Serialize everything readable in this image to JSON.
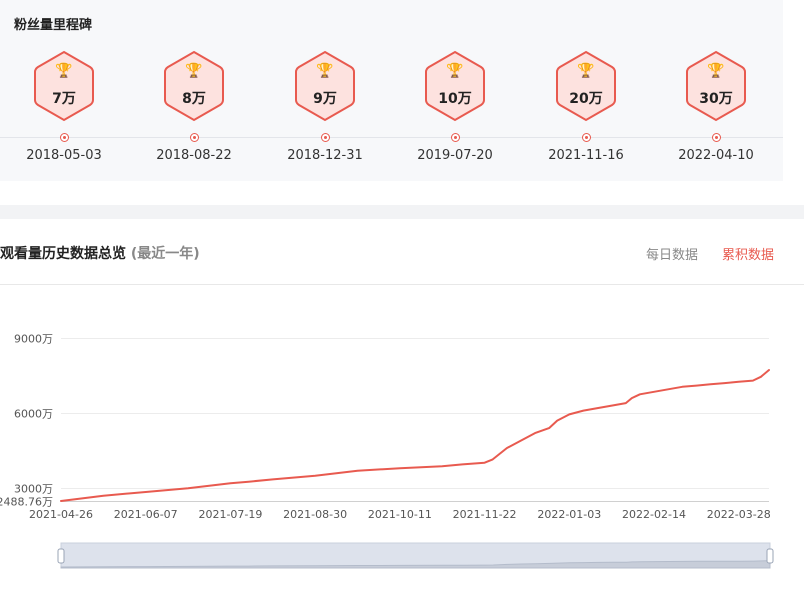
{
  "milestones": {
    "title": "粉丝量里程碑",
    "icon": "trophy-icon",
    "items": [
      {
        "label": "7万",
        "date": "2018-05-03"
      },
      {
        "label": "8万",
        "date": "2018-08-22"
      },
      {
        "label": "9万",
        "date": "2018-12-31"
      },
      {
        "label": "10万",
        "date": "2019-07-20"
      },
      {
        "label": "20万",
        "date": "2021-11-16"
      },
      {
        "label": "30万",
        "date": "2022-04-10"
      }
    ]
  },
  "views": {
    "title": "观看量历史数据总览",
    "subtitle": "(最近一年)",
    "tabs": [
      {
        "label": "每日数据",
        "active": false
      },
      {
        "label": "累积数据",
        "active": true
      }
    ]
  },
  "colors": {
    "accent": "#e85a4f",
    "hex_fill": "#fde2df",
    "zoom_fill": "#dde2ec"
  },
  "chart_data": {
    "type": "line",
    "x": [
      "2021-04-26",
      "2021-05-17",
      "2021-06-07",
      "2021-06-28",
      "2021-07-19",
      "2021-07-28",
      "2021-08-09",
      "2021-08-30",
      "2021-09-20",
      "2021-10-11",
      "2021-11-01",
      "2021-11-11",
      "2021-11-22",
      "2021-11-26",
      "2021-12-03",
      "2021-12-10",
      "2021-12-17",
      "2021-12-24",
      "2021-12-28",
      "2022-01-03",
      "2022-01-10",
      "2022-01-17",
      "2022-01-24",
      "2022-01-31",
      "2022-02-03",
      "2022-02-07",
      "2022-02-14",
      "2022-02-21",
      "2022-02-28",
      "2022-03-07",
      "2022-03-14",
      "2022-03-21",
      "2022-03-28",
      "2022-04-04",
      "2022-04-08",
      "2022-04-12"
    ],
    "values": [
      2488.76,
      2700,
      2850,
      3000,
      3200,
      3260,
      3350,
      3500,
      3700,
      3800,
      3880,
      3950,
      4020,
      4150,
      4600,
      4900,
      5200,
      5400,
      5700,
      5950,
      6100,
      6200,
      6300,
      6400,
      6600,
      6750,
      6850,
      6950,
      7050,
      7100,
      7150,
      7200,
      7250,
      7300,
      7450,
      7720
    ],
    "series": [
      {
        "values": [
          2488.76,
          2700,
          2850,
          3000,
          3200,
          3260,
          3350,
          3500,
          3700,
          3800,
          3880,
          3950,
          4020,
          4150,
          4600,
          4900,
          5200,
          5400,
          5700,
          5950,
          6100,
          6200,
          6300,
          6400,
          6600,
          6750,
          6850,
          6950,
          7050,
          7100,
          7150,
          7200,
          7250,
          7300,
          7450,
          7720
        ]
      }
    ],
    "x_ticks": [
      "2021-04-26",
      "2021-06-07",
      "2021-07-19",
      "2021-08-30",
      "2021-10-11",
      "2021-11-22",
      "2022-01-03",
      "2022-02-14",
      "2022-03-28"
    ],
    "y_ticks": [
      {
        "value": 9000,
        "label": "9000万"
      },
      {
        "value": 6000,
        "label": "6000万"
      },
      {
        "value": 3000,
        "label": "3000万"
      },
      {
        "value": 2488.76,
        "label": "2488.76万"
      }
    ],
    "ylim": [
      2488.76,
      9000
    ],
    "xlim": [
      "2021-04-26",
      "2022-04-12"
    ],
    "grid": true,
    "legend": "none"
  }
}
